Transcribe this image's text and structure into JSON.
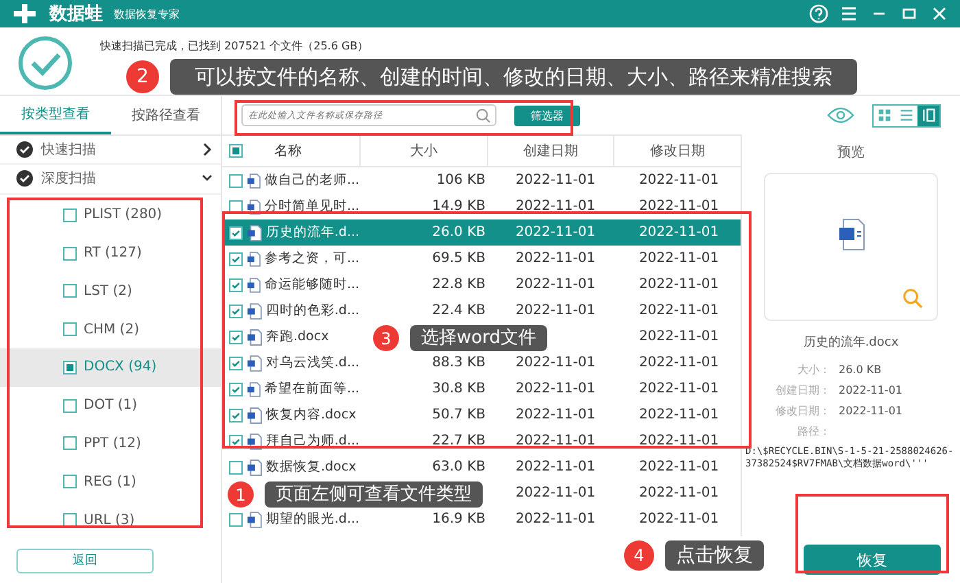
{
  "window": {
    "app_name": "数据蛙",
    "subtitle": "数据恢复专家"
  },
  "scan_status": {
    "line": "快速扫描已完成，已找到 207521 个文件（25.6 GB）"
  },
  "search": {
    "placeholder": "在此处输入文件名称或保存路径",
    "filter_button": "筛选器"
  },
  "view_modes": [
    {
      "kind": "grid",
      "selected": false
    },
    {
      "kind": "list",
      "selected": false
    },
    {
      "kind": "detail",
      "selected": true
    }
  ],
  "sidebar": {
    "tabs": [
      {
        "label": "按类型查看",
        "selected": true
      },
      {
        "label": "按路径查看",
        "selected": false
      }
    ],
    "groups": [
      {
        "label": "快速扫描",
        "expanded": false
      },
      {
        "label": "深度扫描",
        "expanded": true
      }
    ],
    "items": [
      {
        "label": "PLIST (280)",
        "checked": false,
        "selected": false
      },
      {
        "label": "RT (127)",
        "checked": false,
        "selected": false
      },
      {
        "label": "LST (2)",
        "checked": false,
        "selected": false
      },
      {
        "label": "CHM (2)",
        "checked": false,
        "selected": false
      },
      {
        "label": "DOCX (94)",
        "checked": true,
        "selected": true
      },
      {
        "label": "DOT (1)",
        "checked": false,
        "selected": false
      },
      {
        "label": "PPT (12)",
        "checked": false,
        "selected": false
      },
      {
        "label": "REG (1)",
        "checked": false,
        "selected": false
      },
      {
        "label": "URL (3)",
        "checked": false,
        "selected": false
      }
    ],
    "back_button": "返回"
  },
  "table": {
    "select_all_checked": true,
    "columns": [
      "名称",
      "大小",
      "创建日期",
      "修改日期"
    ],
    "rows": [
      {
        "name": "做自己的老师...",
        "size": "106 KB",
        "created": "2022-11-01",
        "modified": "2022-11-01",
        "checked": false,
        "selected": false
      },
      {
        "name": "分时简单见时...",
        "size": "14.9 KB",
        "created": "2022-11-01",
        "modified": "2022-11-01",
        "checked": false,
        "selected": false
      },
      {
        "name": "历史的流年.d...",
        "size": "26.0 KB",
        "created": "2022-11-01",
        "modified": "2022-11-01",
        "checked": true,
        "selected": true
      },
      {
        "name": "参考之资，可...",
        "size": "69.5 KB",
        "created": "2022-11-01",
        "modified": "2022-11-01",
        "checked": true,
        "selected": false
      },
      {
        "name": "命运能够随时...",
        "size": "22.8 KB",
        "created": "2022-11-01",
        "modified": "2022-11-01",
        "checked": true,
        "selected": false
      },
      {
        "name": "四时的色彩.d...",
        "size": "22.4 KB",
        "created": "2022-11-01",
        "modified": "2022-11-01",
        "checked": true,
        "selected": false
      },
      {
        "name": "奔跑.docx",
        "modified": "2022-11-01",
        "checked": true,
        "selected": false
      },
      {
        "name": "对乌云浅笑.d...",
        "size": "88.3 KB",
        "created": "2022-11-01",
        "modified": "2022-11-01",
        "checked": true,
        "selected": false
      },
      {
        "name": "希望在前面等...",
        "size": "30.8 KB",
        "created": "2022-11-01",
        "modified": "2022-11-01",
        "checked": true,
        "selected": false
      },
      {
        "name": "恢复内容.docx",
        "size": "50.7 KB",
        "created": "2022-11-01",
        "modified": "2022-11-01",
        "checked": true,
        "selected": false
      },
      {
        "name": "拜自己为师.d...",
        "size": "22.7 KB",
        "created": "2022-11-01",
        "modified": "2022-11-01",
        "checked": true,
        "selected": false
      },
      {
        "name": "数据恢复.docx",
        "size": "63.0 KB",
        "created": "2022-11-01",
        "modified": "2022-11-01",
        "checked": false,
        "selected": false
      },
      {
        "created": "2022-11-01",
        "modified": "2022-11-01",
        "selected": false
      },
      {
        "name": "期望的眼光.d...",
        "size": "16.9 KB",
        "created": "2022-11-01",
        "modified": "2022-11-01",
        "checked": false,
        "selected": false
      }
    ]
  },
  "preview": {
    "title": "预览",
    "file_name": "历史的流年.docx",
    "fields": [
      {
        "label": "大小：",
        "value": "26.0 KB"
      },
      {
        "label": "创建日期：",
        "value": "2022-11-01"
      },
      {
        "label": "修改日期：",
        "value": "2022-11-01"
      },
      {
        "label": "路径："
      }
    ],
    "path": "D:\\$RECYCLE.BIN\\S-1-5-21-2588024626-37382524$RV7FMAB\\文档数据word\\'''"
  },
  "recover_button": "恢复",
  "callouts": [
    {
      "number": "1",
      "text": "页面左侧可查看文件类型"
    },
    {
      "number": "2",
      "text": "可以按文件的名称、创建的时间、修改的日期、大小、路径来精准搜索"
    },
    {
      "number": "3",
      "text": "选择word文件"
    },
    {
      "number": "4",
      "text": "点击恢复"
    }
  ]
}
